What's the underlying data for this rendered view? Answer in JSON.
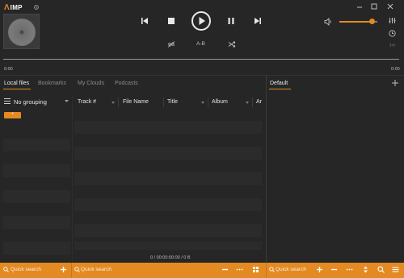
{
  "app": {
    "logo_mark": "Λ",
    "logo_text": "IMP"
  },
  "window_controls": [
    "minimize-icon",
    "maximize-icon",
    "close-icon"
  ],
  "player": {
    "ab_label": "A-B",
    "time_elapsed": "0:00",
    "time_total": "0:00",
    "progress": 0,
    "volume": 0.85
  },
  "tabs": [
    {
      "label": "Local files",
      "active": true
    },
    {
      "label": "Bookmarks",
      "active": false
    },
    {
      "label": "My Clouds",
      "active": false
    },
    {
      "label": "Podcasts",
      "active": false
    }
  ],
  "left_panel": {
    "grouping_label": "No grouping",
    "group_button_label": "*",
    "search_placeholder": "Quick search"
  },
  "table": {
    "columns": [
      "Track #",
      "File Name",
      "Title",
      "Album",
      "Ar"
    ],
    "summary": "0 / 00:00:00:00 / 0 B",
    "search_placeholder": "Quick search"
  },
  "playlist": {
    "tab_label": "Default",
    "search_placeholder": "Quick search"
  },
  "colors": {
    "accent": "#e48a22",
    "background": "#262626",
    "row": "#2b2b2b"
  }
}
